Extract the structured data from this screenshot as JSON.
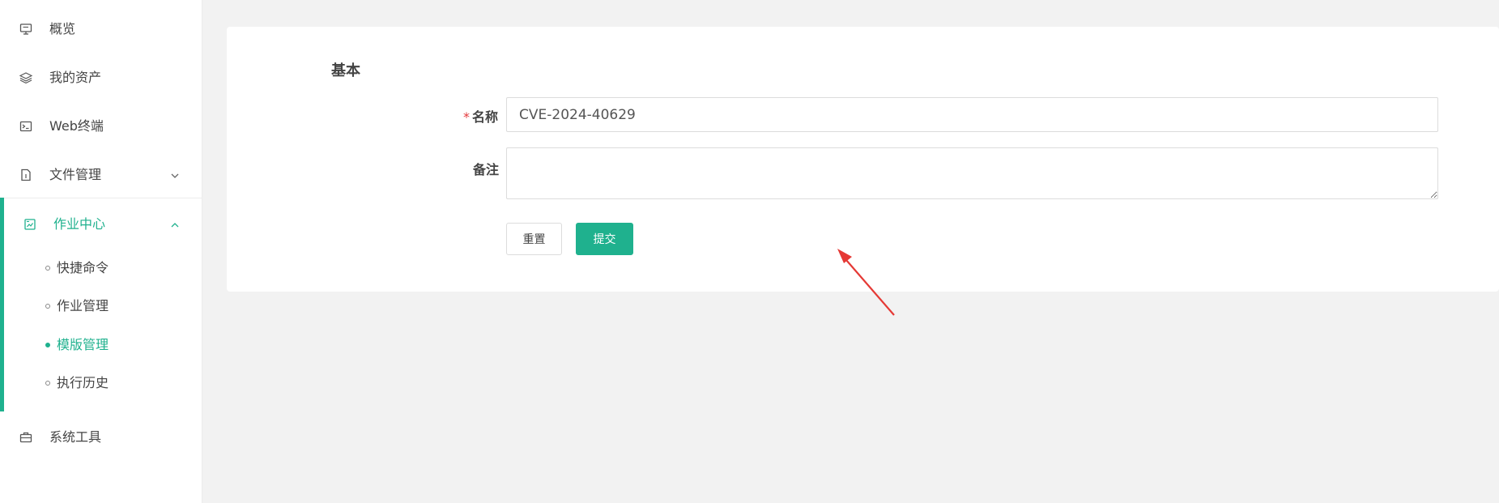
{
  "sidebar": {
    "items": [
      {
        "label": "概览",
        "icon": "monitor-icon"
      },
      {
        "label": "我的资产",
        "icon": "layers-icon"
      },
      {
        "label": "Web终端",
        "icon": "terminal-icon"
      },
      {
        "label": "文件管理",
        "icon": "file-icon"
      },
      {
        "label": "作业中心",
        "icon": "job-icon"
      },
      {
        "label": "系统工具",
        "icon": "briefcase-icon"
      }
    ],
    "submenu": [
      {
        "label": "快捷命令"
      },
      {
        "label": "作业管理"
      },
      {
        "label": "模版管理"
      },
      {
        "label": "执行历史"
      }
    ],
    "active_group": "作业中心",
    "active_item": "模版管理"
  },
  "form": {
    "section_title": "基本",
    "name_required_mark": "*",
    "name_label": "名称",
    "name_value": "CVE-2024-40629",
    "remark_label": "备注",
    "remark_value": "",
    "reset_label": "重置",
    "submit_label": "提交"
  },
  "colors": {
    "accent": "#1fb18e",
    "arrow": "#e53935",
    "required": "#e4393c"
  }
}
